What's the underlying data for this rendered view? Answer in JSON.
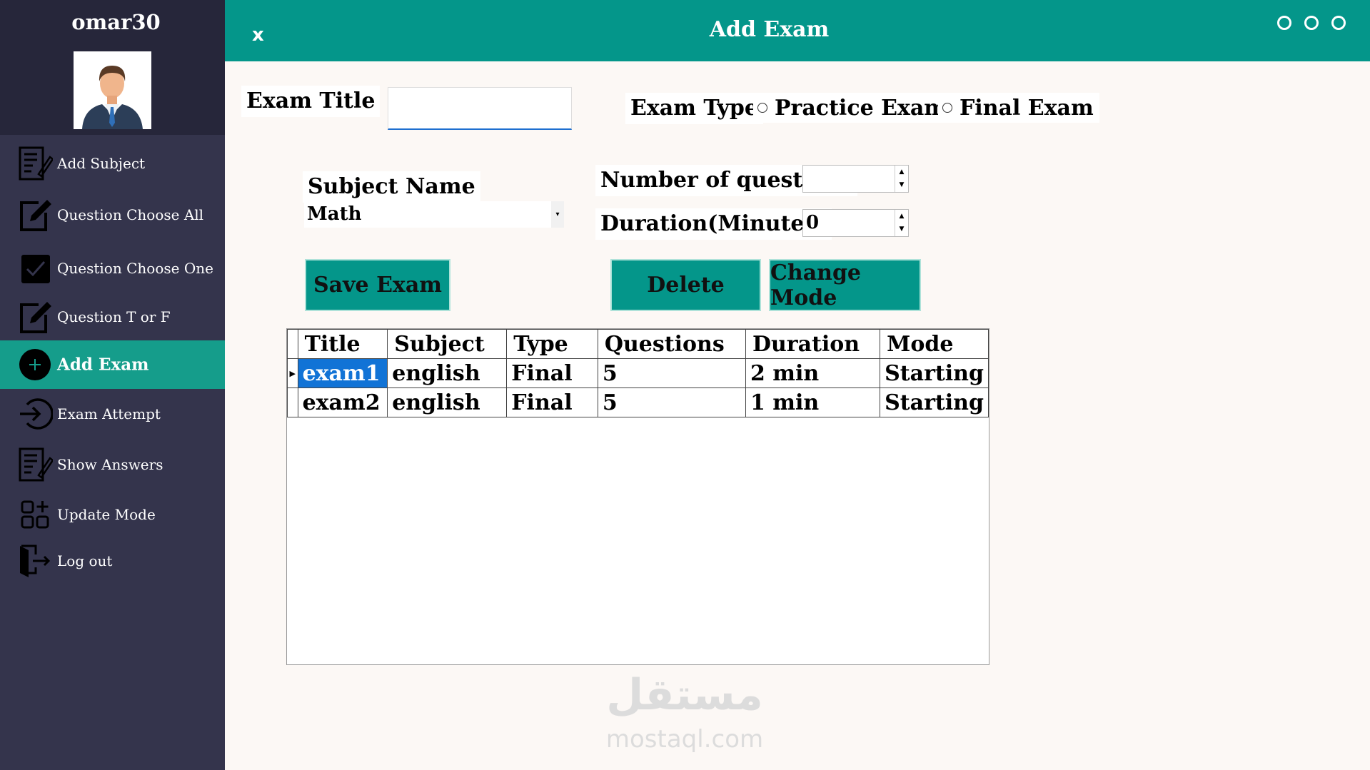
{
  "sidebar": {
    "username": "omar30",
    "items": [
      {
        "label": "Add Subject"
      },
      {
        "label": "Question Choose All"
      },
      {
        "label": "Question Choose One"
      },
      {
        "label": "Question T or F"
      },
      {
        "label": "Add Exam",
        "active": true
      },
      {
        "label": "Exam Attempt"
      },
      {
        "label": "Show Answers"
      },
      {
        "label": "Update Mode"
      },
      {
        "label": "Log out"
      }
    ]
  },
  "header": {
    "close_label": "x",
    "title": "Add Exam",
    "window_controls": [
      "o",
      "o",
      "o"
    ]
  },
  "form": {
    "exam_title_label": "Exam Title",
    "exam_title_value": "",
    "exam_type_label": "Exam Type",
    "practice_label": "Practice Exam",
    "final_label": "Final Exam",
    "subject_name_label": "Subject Name",
    "subject_value": "Math",
    "num_questions_label": "Number of questions",
    "num_questions_value": "",
    "duration_label": "Duration(Minutes)",
    "duration_value": "0"
  },
  "buttons": {
    "save": "Save Exam",
    "delete": "Delete",
    "change_mode": "Change Mode"
  },
  "table": {
    "columns": [
      "Title",
      "Subject",
      "Type",
      "Questions",
      "Duration",
      "Mode"
    ],
    "rows": [
      [
        "exam1",
        "english",
        "Final",
        "5",
        "2 min",
        "Starting"
      ],
      [
        "exam2",
        "english",
        "Final",
        "5",
        "1 min",
        "Starting"
      ]
    ]
  },
  "watermark": {
    "arabic": "مستقل",
    "latin": "mostaql.com"
  },
  "colors": {
    "accent": "#04968a",
    "sidebar": "#34344c",
    "sidebar_header": "#26263a",
    "active_item": "#159d8b",
    "selection": "#1173d6"
  }
}
